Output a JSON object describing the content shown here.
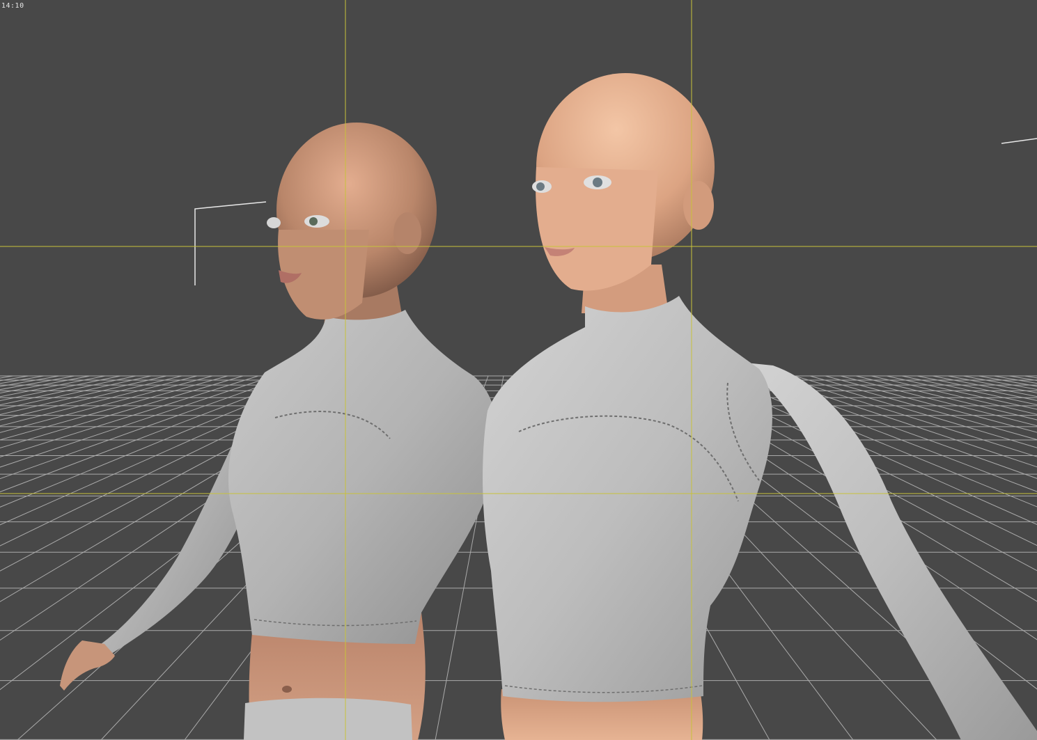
{
  "viewport": {
    "aspect_ratio_label": "14:10",
    "colors": {
      "background": "#484848",
      "guide_lines": "#c8c23a",
      "ground_grid": "#bdbdbd",
      "skin": "#d9a184",
      "shirt": "#b9b9b9"
    }
  },
  "scene": {
    "figures": [
      {
        "name": "figure-left",
        "description_icon": "human-figure-icon"
      },
      {
        "name": "figure-right",
        "description_icon": "human-figure-icon"
      }
    ],
    "guides": {
      "type": "rule-of-thirds"
    }
  }
}
